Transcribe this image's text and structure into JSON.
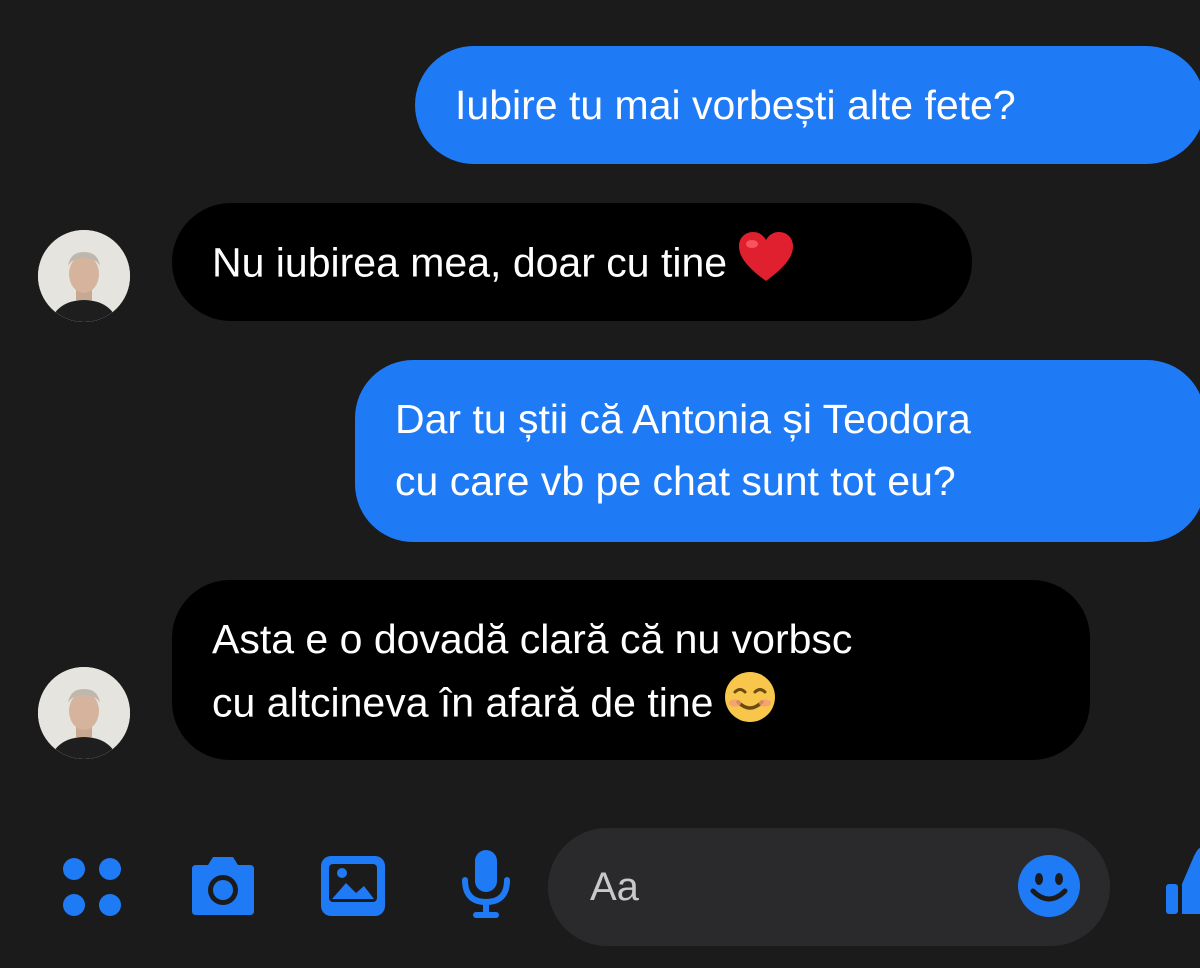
{
  "messages": [
    {
      "direction": "out",
      "lines": [
        "Iubire tu mai vorbești alte fete?"
      ]
    },
    {
      "direction": "in",
      "lines": [
        "Nu iubirea mea, doar cu tine"
      ],
      "emoji": "red-heart-emoji"
    },
    {
      "direction": "out",
      "lines": [
        "Dar tu știi că Antonia și Teodora",
        "cu care vb pe chat sunt tot eu?"
      ]
    },
    {
      "direction": "in",
      "lines": [
        "Asta e o dovadă clară că nu vorbsc",
        "cu altcineva în afară de tine"
      ],
      "emoji": "smiling-face-emoji"
    }
  ],
  "composer": {
    "placeholder": "Aa",
    "icons": [
      "menu-dots-icon",
      "camera-icon",
      "gallery-icon",
      "microphone-icon",
      "emoji-icon",
      "like-icon"
    ]
  },
  "colors": {
    "background": "#1b1b1c",
    "outgoing_bubble": "#1f7af5",
    "incoming_bubble": "#000000",
    "accent": "#1f7af5",
    "input_background": "#2a2a2c"
  }
}
